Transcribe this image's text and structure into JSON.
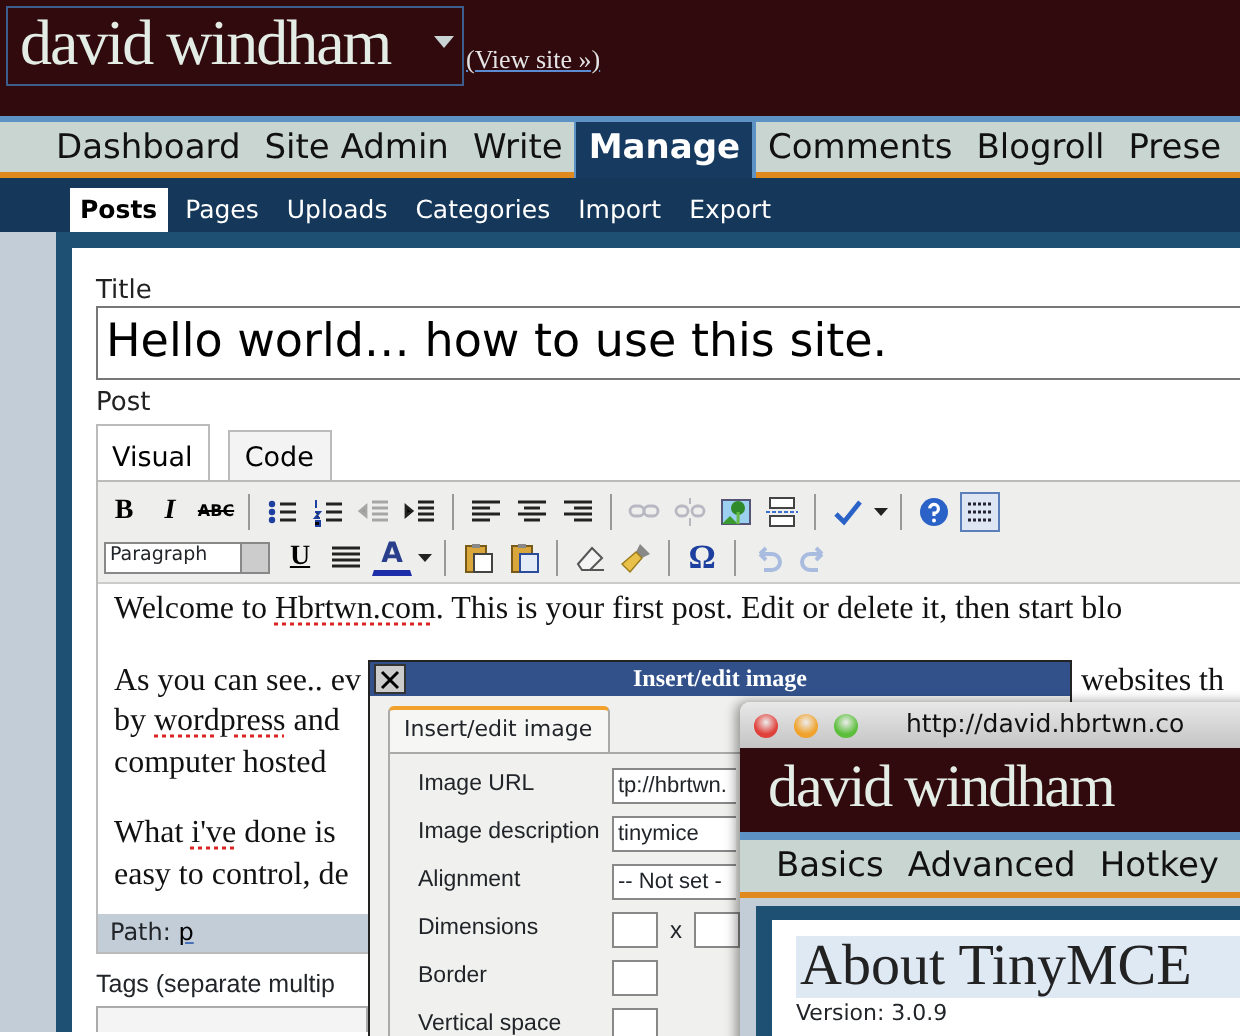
{
  "header": {
    "site_title": "david windham",
    "view_site": "(View site »)"
  },
  "main_nav": [
    {
      "label": "Dashboard",
      "selected": false
    },
    {
      "label": "Site Admin",
      "selected": false
    },
    {
      "label": "Write",
      "selected": false
    },
    {
      "label": "Manage",
      "selected": true
    },
    {
      "label": "Comments",
      "selected": false
    },
    {
      "label": "Blogroll",
      "selected": false
    },
    {
      "label": "Prese",
      "selected": false
    }
  ],
  "sub_nav": [
    {
      "label": "Posts",
      "selected": true
    },
    {
      "label": "Pages",
      "selected": false
    },
    {
      "label": "Uploads",
      "selected": false
    },
    {
      "label": "Categories",
      "selected": false
    },
    {
      "label": "Import",
      "selected": false
    },
    {
      "label": "Export",
      "selected": false
    }
  ],
  "title_label": "Title",
  "title_value": "Hello world… how to use this site.",
  "post_label": "Post",
  "editor_tabs": [
    {
      "label": "Visual",
      "selected": true
    },
    {
      "label": "Code",
      "selected": false
    }
  ],
  "toolbar_rows": [
    [
      {
        "kind": "glyph",
        "text": "B",
        "disabled": false,
        "pressed": false
      },
      {
        "kind": "glyph",
        "text": "I",
        "disabled": false,
        "pressed": false
      },
      {
        "kind": "glyph",
        "text": "ABC",
        "disabled": false,
        "pressed": false
      },
      {
        "kind": "separator"
      },
      {
        "kind": "icon",
        "disabled": false,
        "pressed": false
      },
      {
        "kind": "icon",
        "disabled": false,
        "pressed": false
      },
      {
        "kind": "icon",
        "disabled": true,
        "pressed": false
      },
      {
        "kind": "icon",
        "disabled": false,
        "pressed": false
      },
      {
        "kind": "separator"
      },
      {
        "kind": "icon",
        "disabled": false,
        "pressed": false
      },
      {
        "kind": "icon",
        "disabled": false,
        "pressed": false
      },
      {
        "kind": "icon",
        "disabled": false,
        "pressed": false
      },
      {
        "kind": "separator"
      },
      {
        "kind": "icon",
        "disabled": true,
        "pressed": false
      },
      {
        "kind": "icon",
        "disabled": true,
        "pressed": false
      },
      {
        "kind": "icon",
        "disabled": false,
        "pressed": false
      },
      {
        "kind": "icon",
        "disabled": false,
        "pressed": false
      },
      {
        "kind": "separator"
      },
      {
        "kind": "icon",
        "disabled": false,
        "pressed": false
      },
      {
        "kind": "caret"
      },
      {
        "kind": "separator"
      },
      {
        "kind": "icon",
        "disabled": false,
        "pressed": false
      },
      {
        "kind": "icon",
        "disabled": false,
        "pressed": true
      }
    ],
    [
      {
        "kind": "select",
        "text": "Paragraph"
      },
      {
        "kind": "glyph",
        "text": "U",
        "disabled": false,
        "pressed": false
      },
      {
        "kind": "icon",
        "disabled": false,
        "pressed": false
      },
      {
        "kind": "glyph",
        "text": "A",
        "disabled": false,
        "pressed": false
      },
      {
        "kind": "caret"
      },
      {
        "kind": "separator"
      },
      {
        "kind": "icon",
        "disabled": false,
        "pressed": false
      },
      {
        "kind": "icon",
        "disabled": false,
        "pressed": false
      },
      {
        "kind": "separator"
      },
      {
        "kind": "icon",
        "disabled": false,
        "pressed": false
      },
      {
        "kind": "icon",
        "disabled": false,
        "pressed": false
      },
      {
        "kind": "separator"
      },
      {
        "kind": "glyph",
        "text": "Ω",
        "disabled": false,
        "pressed": false
      },
      {
        "kind": "separator"
      },
      {
        "kind": "icon",
        "disabled": true,
        "pressed": false
      },
      {
        "kind": "icon",
        "disabled": true,
        "pressed": false
      }
    ]
  ],
  "editor_paragraphs": [
    [
      {
        "left": [
          {
            "text": "Welcome to ",
            "misspelled": false
          },
          {
            "text": "Hbrtwn.com",
            "misspelled": true
          },
          {
            "text": ". This is your first post. Edit or delete it, then start blo",
            "misspelled": false
          }
        ]
      }
    ],
    [
      {
        "left": [
          {
            "text": "As you can see.. ev",
            "misspelled": false
          }
        ],
        "right": "websites th"
      },
      {
        "left": [
          {
            "text": "by ",
            "misspelled": false
          },
          {
            "text": "wordpress",
            "misspelled": true
          },
          {
            "text": " and",
            "misspelled": false
          }
        ]
      },
      {
        "left": [
          {
            "text": "computer hosted",
            "misspelled": false
          }
        ]
      }
    ],
    [
      {
        "left": [
          {
            "text": "What ",
            "misspelled": false
          },
          {
            "text": "i've",
            "misspelled": true
          },
          {
            "text": " done is",
            "misspelled": false
          }
        ]
      },
      {
        "left": [
          {
            "text": "easy to control, de",
            "misspelled": false
          }
        ]
      }
    ]
  ],
  "path_label": "Path:",
  "path_value": "p",
  "tags_label": "Tags (separate multip",
  "image_dialog": {
    "title": "Insert/edit image",
    "tab": {
      "label": "Insert/edit image",
      "selected": true
    },
    "fields": [
      {
        "label": "Image URL",
        "kind": "text",
        "value": "tp://hbrtwn."
      },
      {
        "label": "Image description",
        "kind": "text",
        "value": "tinymice"
      },
      {
        "label": "Alignment",
        "kind": "select",
        "value": "-- Not set -"
      },
      {
        "label": "Dimensions",
        "kind": "pair",
        "separator": "x"
      },
      {
        "label": "Border",
        "kind": "small"
      },
      {
        "label": "Vertical space",
        "kind": "small"
      }
    ]
  },
  "browser_window": {
    "url": "http://david.hbrtwn.co",
    "site_title": "david windham",
    "tabs": [
      "Basics",
      "Advanced",
      "Hotkey"
    ],
    "heading": "About TinyMCE",
    "version": "Version: 3.0.9"
  }
}
